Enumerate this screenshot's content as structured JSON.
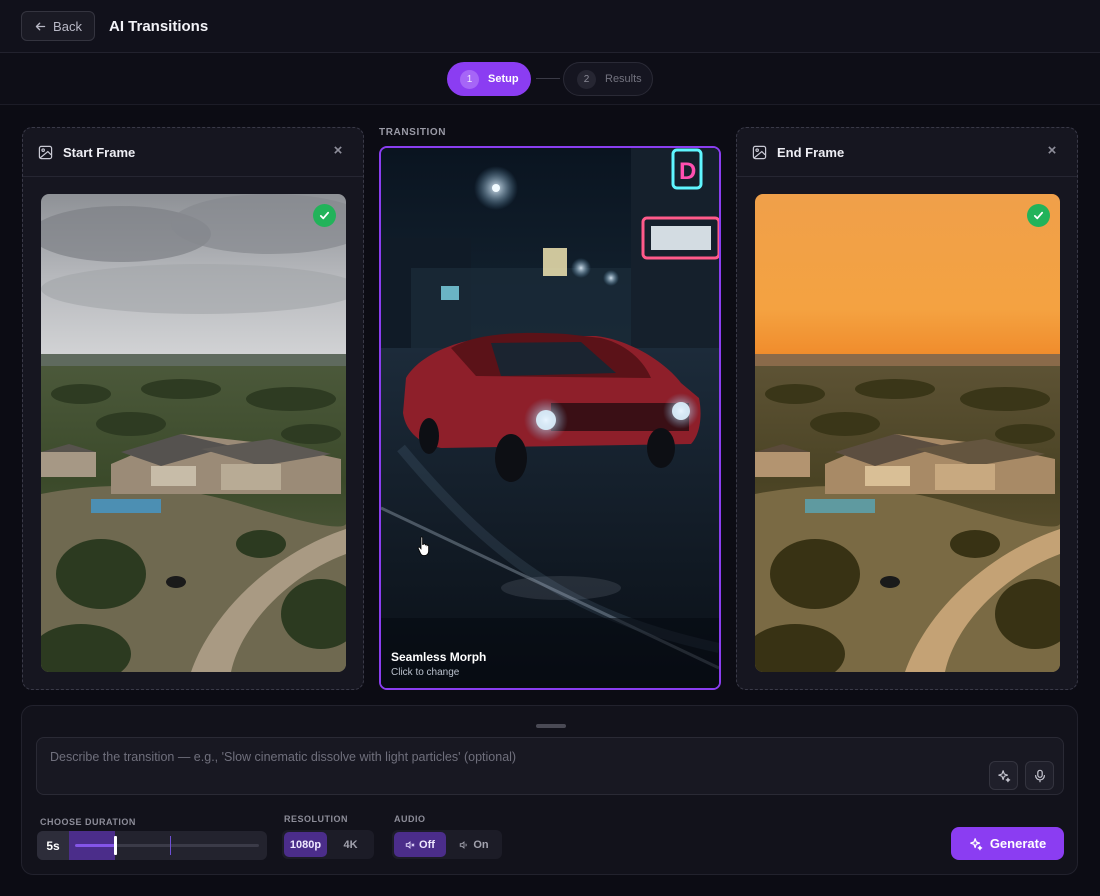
{
  "header": {
    "back_label": "Back",
    "title": "AI Transitions"
  },
  "stepper": {
    "steps": [
      {
        "number": "1",
        "label": "Setup",
        "active": true
      },
      {
        "number": "2",
        "label": "Results",
        "active": false
      }
    ]
  },
  "start_frame": {
    "title": "Start Frame",
    "close_glyph": "×",
    "image_description_icon": "image-icon",
    "has_check": true
  },
  "transition": {
    "section_label": "TRANSITION",
    "title": "Seamless Morph",
    "subtitle": "Click to change"
  },
  "end_frame": {
    "title": "End Frame",
    "close_glyph": "×",
    "has_check": true
  },
  "prompt": {
    "placeholder": "Describe the transition — e.g., 'Slow cinematic dissolve with light particles' (optional)",
    "value": ""
  },
  "duration": {
    "label": "CHOOSE DURATION",
    "value_label": "5s",
    "level": 0.22
  },
  "resolution": {
    "label": "RESOLUTION",
    "options": [
      "1080p",
      "4K"
    ],
    "selected": "1080p"
  },
  "audio": {
    "label": "AUDIO",
    "options": [
      "Off",
      "On"
    ],
    "selected": "Off"
  },
  "generate_label": "Generate",
  "colors": {
    "accent": "#8b3df2",
    "success": "#22b35a",
    "background": "#0c0c14"
  }
}
